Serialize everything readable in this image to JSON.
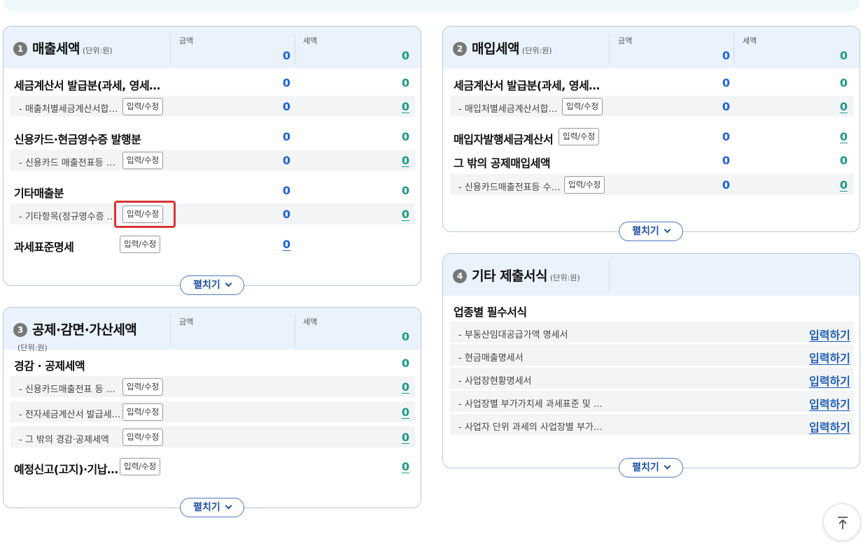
{
  "common": {
    "edit_label": "입력/수정",
    "expand_label": "펼치기",
    "write_label": "입력하기",
    "amount_label": "금액",
    "tax_label": "세액"
  },
  "sales": {
    "num": "1",
    "title": "매출세액",
    "unit": "(단위:원)",
    "amount": "0",
    "tax": "0",
    "rows": [
      {
        "label": "세금계산서 발급분(과세, 영세…",
        "amount": "0",
        "tax": "0"
      },
      {
        "label": "- 매출처별세금계산서합…",
        "amount": "0",
        "tax": "0"
      },
      {
        "label": "신용카드·현금영수증 발행분",
        "amount": "0",
        "tax": "0"
      },
      {
        "label": "- 신용카드 매출전표등 …",
        "amount": "0",
        "tax": "0"
      },
      {
        "label": "기타매출분",
        "amount": "0",
        "tax": "0"
      },
      {
        "label": "- 기타항목(정규영수증 …",
        "amount": "0",
        "tax": "0"
      },
      {
        "label": "과세표준명세",
        "amount": "0"
      }
    ]
  },
  "purchase": {
    "num": "2",
    "title": "매입세액",
    "unit": "(단위:원)",
    "amount": "0",
    "tax": "0",
    "rows": [
      {
        "label": "세금계산서 발급분(과세, 영세…",
        "amount": "0",
        "tax": "0"
      },
      {
        "label": "- 매입처별세금계산서합…",
        "amount": "0",
        "tax": "0"
      },
      {
        "label": "매입자발행세금계산서",
        "amount": "0",
        "tax": "0"
      },
      {
        "label": "그 밖의 공제매입세액",
        "amount": "0",
        "tax": "0"
      },
      {
        "label": "- 신용카드매출전표등 수…",
        "amount": "0",
        "tax": "0"
      }
    ]
  },
  "deduction": {
    "num": "3",
    "title": "공제·감면·가산세액",
    "unit": "(단위:원)",
    "tax": "0",
    "rows": [
      {
        "label": "경감 · 공제세액",
        "tax": "0"
      },
      {
        "label": "- 신용카드매출전표 등 …",
        "tax": "0"
      },
      {
        "label": "- 전자세금계산서 발급세…",
        "tax": "0"
      },
      {
        "label": "- 그 밖의 경감·공제세액",
        "tax": "0"
      },
      {
        "label": "예정신고(고지)·기납…",
        "tax": "0"
      }
    ]
  },
  "other": {
    "num": "4",
    "title": "기타 제출서식",
    "unit": "(단위:원)",
    "section_label": "업종별 필수서식",
    "rows": [
      {
        "label": "- 부동산임대공급가액 명세서"
      },
      {
        "label": "- 현금매출명세서"
      },
      {
        "label": "- 사업장현황명세서"
      },
      {
        "label": "- 사업장별 부가가치세 과세표준 및 …"
      },
      {
        "label": "- 사업자 단위 과세의 사업장별 부가…"
      }
    ]
  },
  "colors": {
    "amount_blue": "#1e63d6",
    "tax_teal": "#1c9a8a",
    "highlight_red": "#d83434",
    "header_bg": "#eaf3fd"
  },
  "icons": {
    "scroll_top": "arrow-up-to-top-icon",
    "expand": "chevron-down-icon"
  }
}
